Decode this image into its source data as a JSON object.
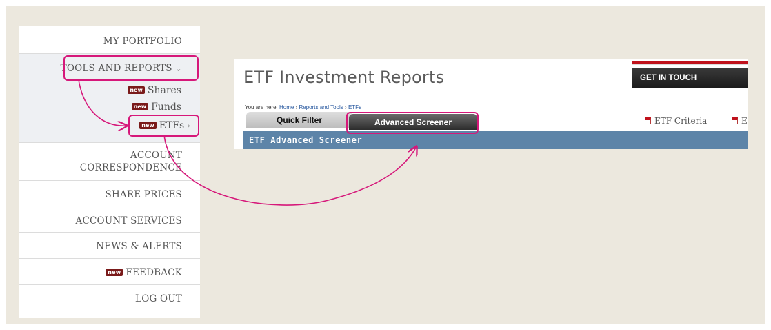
{
  "nav": {
    "items": [
      {
        "label": "MY PORTFOLIO"
      },
      {
        "label": "TOOLS AND REPORTS"
      },
      {
        "label": "ACCOUNT"
      },
      {
        "label": "CORRESPONDENCE"
      },
      {
        "label": "SHARE PRICES"
      },
      {
        "label": "ACCOUNT SERVICES"
      },
      {
        "label": "NEWS & ALERTS"
      },
      {
        "label": "FEEDBACK"
      },
      {
        "label": "LOG OUT"
      }
    ],
    "sub_items": [
      {
        "label": "Shares"
      },
      {
        "label": "Funds"
      },
      {
        "label": "ETFs"
      }
    ],
    "badge_text": "new",
    "chevron_down_glyph": "⌄",
    "chevron_right_glyph": "›"
  },
  "report": {
    "title": "ETF Investment Reports",
    "get_in_touch": "GET IN TOUCH",
    "breadcrumb": {
      "prefix": "You are here:",
      "items": [
        "Home",
        "Reports and Tools",
        "ETFs"
      ],
      "separator": "›"
    },
    "tabs": [
      {
        "label": "Quick Filter"
      },
      {
        "label": "Advanced Screener"
      }
    ],
    "links": [
      {
        "label": "ETF Criteria"
      },
      {
        "label": "E"
      }
    ],
    "section_header": "ETF Advanced Screener"
  },
  "colors": {
    "highlight": "#d6187a",
    "badge": "#7a1a1a",
    "accent_red": "#c0121c",
    "section_bar": "#5d84a8"
  }
}
